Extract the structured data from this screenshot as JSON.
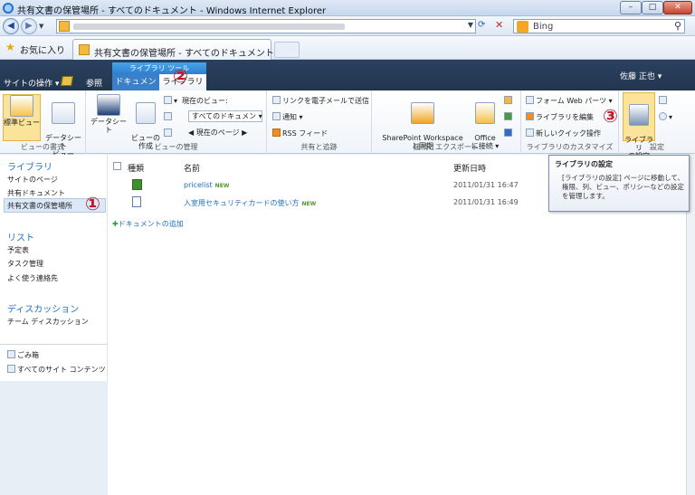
{
  "window": {
    "title": "共有文書の保管場所 - すべてのドキュメント - Windows Internet Explorer",
    "min": "–",
    "max": "□",
    "close": "✕"
  },
  "browser": {
    "search_placeholder": "Bing",
    "favorites_label": "お気に入り",
    "tab_title": "共有文書の保管場所 - すべてのドキュメント"
  },
  "sharepoint": {
    "site_actions": "サイトの操作 ▾",
    "browse": "参照",
    "library_tools": "ライブラリ ツール",
    "tab_documents": "ドキュメント",
    "tab_library": "ライブラリ",
    "user": "佐藤 正也 ▾"
  },
  "ribbon": {
    "groups": {
      "view_format": "ビューの書式",
      "view_manage": "ビューの管理",
      "share_track": "共有と追跡",
      "connect_export": "接続とエクスポート",
      "customize": "ライブラリのカスタマイズ",
      "settings": "設定"
    },
    "standard_view": "標準ビュー",
    "datasheet_view": "データシート\nビュー",
    "datasheet": "データシート",
    "create_view": "ビューの\n作成",
    "current_view_label": "現在のビュー:",
    "current_view_value": "すべてのドキュメン ▾",
    "current_page": "◀ 現在のページ ▶",
    "email_link": "リンクを電子メールで送信",
    "alert": "通知 ▾",
    "rss": "RSS フィード",
    "sharepoint_workspace": "SharePoint Workspace\nと同期",
    "office_connect": "Office\nに接続 ▾",
    "form_web_parts": "フォーム Web パーツ ▾",
    "edit_library": "ライブラリを編集",
    "new_quick_step": "新しいクイック操作",
    "library_settings": "ライブラリ\nの設定"
  },
  "leftnav": {
    "libraries_header": "ライブラリ",
    "site_pages": "サイトのページ",
    "shared_documents": "共有ドキュメント",
    "storage": "共有文書の保管場所",
    "lists_header": "リスト",
    "calendar": "予定表",
    "tasks": "タスク管理",
    "contacts": "よく使う連絡先",
    "discussions_header": "ディスカッション",
    "team_discussion": "チーム ディスカッション",
    "recycle_bin": "ごみ箱",
    "all_site_content": "すべてのサイト コンテンツ"
  },
  "list": {
    "col_type": "種類",
    "col_name": "名前",
    "col_modified": "更新日時",
    "rows": [
      {
        "name": "pricelist",
        "badge": "NEW",
        "modified": "2011/01/31 16:47"
      },
      {
        "name": "入室用セキュリティカードの使い方",
        "badge": "NEW",
        "modified": "2011/01/31 16:49"
      }
    ],
    "add_document": "ドキュメントの追加"
  },
  "tooltip": {
    "title": "ライブラリの設定",
    "body": "[ライブラリの設定] ページに移動して、権限、列、ビュー、ポリシーなどの設定を管理します。"
  },
  "annotations": {
    "one": "①",
    "two": "②",
    "three": "③"
  },
  "colors": {
    "accent": "#1f6fc2",
    "topbar": "#2b4160",
    "annotation": "#c0182b"
  }
}
